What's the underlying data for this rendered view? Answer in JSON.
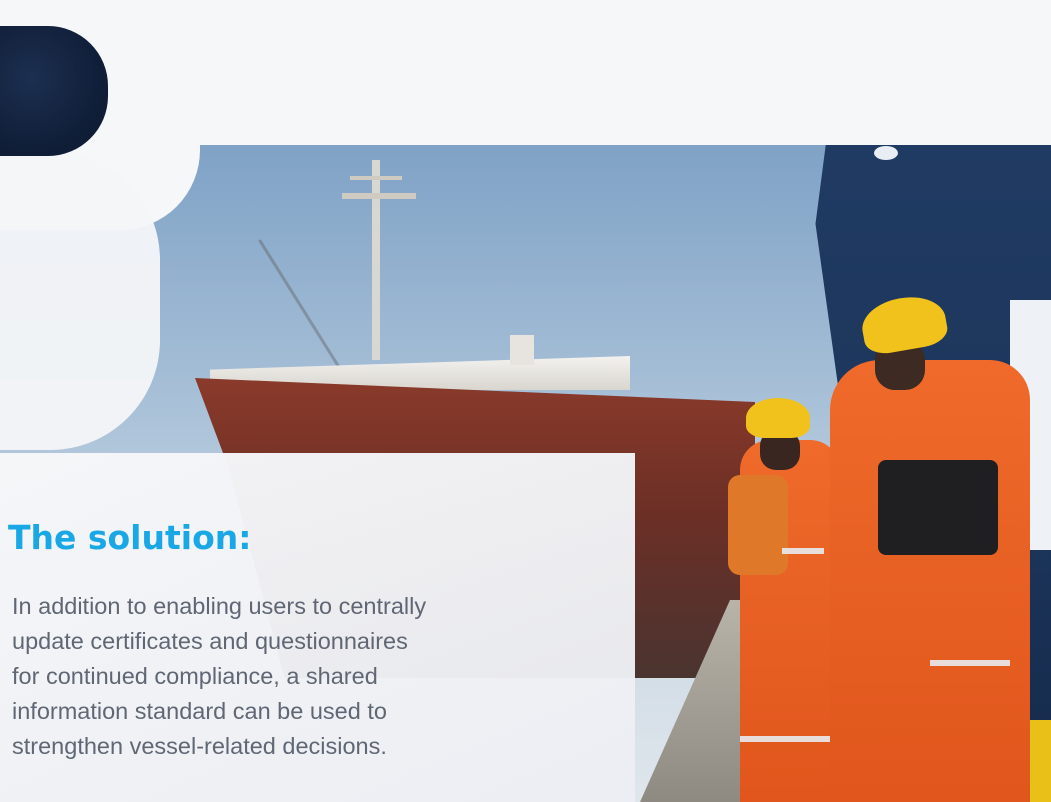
{
  "heading": "The solution:",
  "body_lines": [
    "In addition to enabling users to centrally",
    "update certificates and questionnaires",
    "for continued compliance, a shared",
    "information standard can be used to",
    "strengthen vessel-related decisions."
  ],
  "colors": {
    "accent": "#1aa7e6",
    "body_text": "#606774",
    "navy": "#0f1d36",
    "background": "#f6f7f9"
  },
  "image": {
    "subject": "ship-and-dock-workers-photo"
  }
}
